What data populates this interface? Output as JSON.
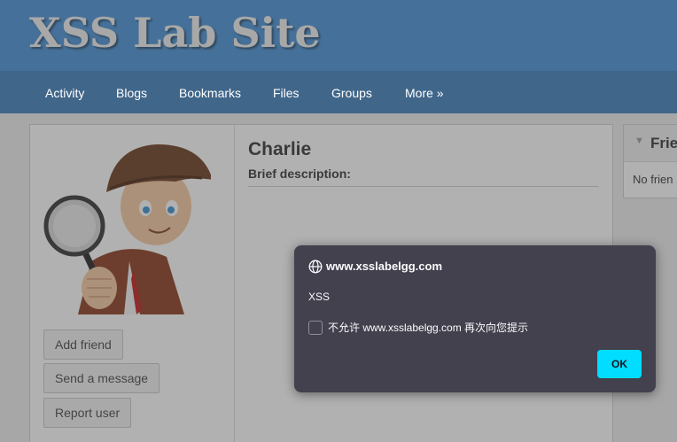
{
  "site": {
    "title": "XSS Lab Site"
  },
  "nav": [
    {
      "label": "Activity"
    },
    {
      "label": "Blogs"
    },
    {
      "label": "Bookmarks"
    },
    {
      "label": "Files"
    },
    {
      "label": "Groups"
    },
    {
      "label": "More »"
    }
  ],
  "profile": {
    "name": "Charlie",
    "brief_label": "Brief description:",
    "avatar_icon": "detective-with-magnifying-glass-avatar"
  },
  "owner_actions": [
    {
      "label": "Add friend"
    },
    {
      "label": "Send a message"
    },
    {
      "label": "Report user"
    }
  ],
  "friends": {
    "title": "Frie",
    "empty_text": "No frien"
  },
  "alert": {
    "origin": "www.xsslabelgg.com",
    "message": "XSS",
    "checkbox_label": "不允许 www.xsslabelgg.com 再次向您提示",
    "checkbox_checked": false,
    "ok_label": "OK"
  },
  "colors": {
    "header": "#4690d6",
    "dialog_bg": "#42414d",
    "ok_button": "#00ddff"
  }
}
